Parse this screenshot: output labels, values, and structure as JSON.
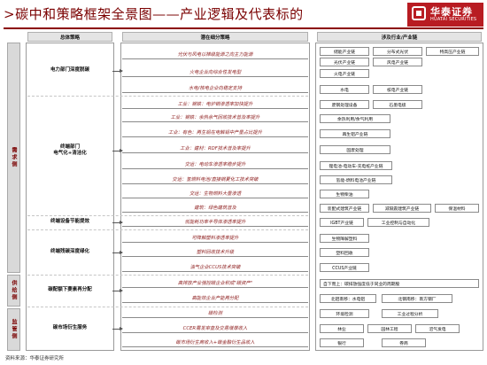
{
  "header": {
    "title": ">碳中和策略框架全景图——产业逻辑及代表标的",
    "logo_cn": "华泰证券",
    "logo_en": "HUATAI SECURITIES"
  },
  "columns": {
    "strategy": "总体策略",
    "middle": "潜在细分策略",
    "right": "涉及行业/产业链"
  },
  "side_labels": {
    "demand": "需求侧",
    "supply": "供给侧",
    "regulation": "监管侧"
  },
  "strategies": {
    "power": "电力部门深度脱碳",
    "terminal_line1": "终端部门",
    "terminal_line2": "电气化+清洁化",
    "equipment": "终端设备节能提效",
    "residual": "终端残碳深度绿化",
    "quota": "碳配额下要素再分配",
    "market": "碳市场衍生服务"
  },
  "middle_items": [
    "光伏与风电以梯级能源之向主力能源",
    "火电企业向综合性发电型",
    "水电/核电企业向稳定支持",
    "工业：钢铁：电炉钢渗透率加快提升",
    "工业：钢铁：余热余气回收技术普及率提升",
    "工业：有色：再生铝在电解铝中产量占比提升",
    "工业：建材：RDF技术普及率提升",
    "交运：电动车渗透率稳步提升",
    "交运：氢燃料电池/直接钢夏化工技术突破",
    "交运：生物燃料大量渗透",
    "建筑：绿色建筑普及",
    "低能耗功率半导体渗透率提升",
    "可降解塑料渗透率提升",
    "塑料回收技术升级",
    "油气企业CCUS技术突破",
    "高排放产业强控碳企业积成\"碳资产\"",
    "高能效企业产能再分配",
    "碳检测",
    "CCER需发审查及交易增厚收入",
    "碳市场衍生商收入+碳金融衍生品收入"
  ],
  "right_items": [
    "储能产业链",
    "分布式光伏",
    "特高压产业链",
    "光伏产业链",
    "风电产业链",
    "火电产业链",
    "水电",
    "核电产业链",
    "废钢处理设备",
    "石墨电极",
    "余热利用/余气利用",
    "再生铝产业链",
    "固废处理",
    "锂电池-电动车-充电桩产业链",
    "氢能-燃料电池产业链",
    "生物柴油",
    "装配式建筑产业链",
    "减隔震建筑产业链",
    "保温材料",
    "IGBT产业链",
    "工业控制与自动化",
    "生物降解塑料",
    "塑料回收",
    "CCUS产业链",
    "自下而上：碳排放强度低于同业的周期股",
    "北铝南移：水电铝",
    "北钢南移：南方钢厂",
    "环境检测",
    "工业过程分析",
    "林业",
    "园林工程",
    "沼气发电",
    "银行",
    "券商"
  ],
  "footer": {
    "source": "资料来源：华泰证券研究所"
  }
}
